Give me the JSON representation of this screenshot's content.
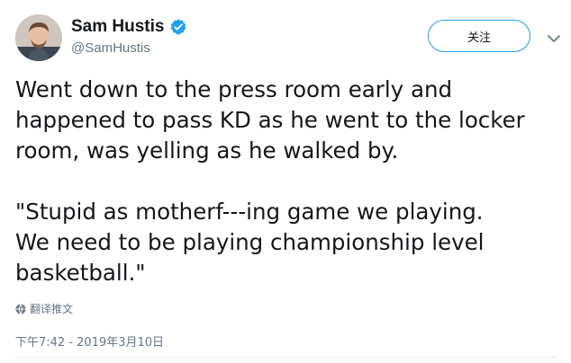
{
  "user": {
    "display_name": "Sam Hustis",
    "handle": "@SamHustis",
    "verified": true
  },
  "follow_label": "关注",
  "tweet": {
    "paragraph_1": "Went down to the press room early and\nhappened to pass KD as he went to the locker\nroom, was yelling as he walked by.",
    "paragraph_2": "\"Stupid as motherf---ing game we playing.\nWe need to be playing championship level\nbasketball.\""
  },
  "translate_label": "翻译推文",
  "timestamp": "下午7:42 - 2019年3月10日",
  "colors": {
    "accent": "#1da1f2",
    "text": "#14171a",
    "muted": "#657786"
  },
  "icons": {
    "verified": "verified-badge-icon",
    "caret": "chevron-down-icon",
    "globe": "globe-icon"
  }
}
